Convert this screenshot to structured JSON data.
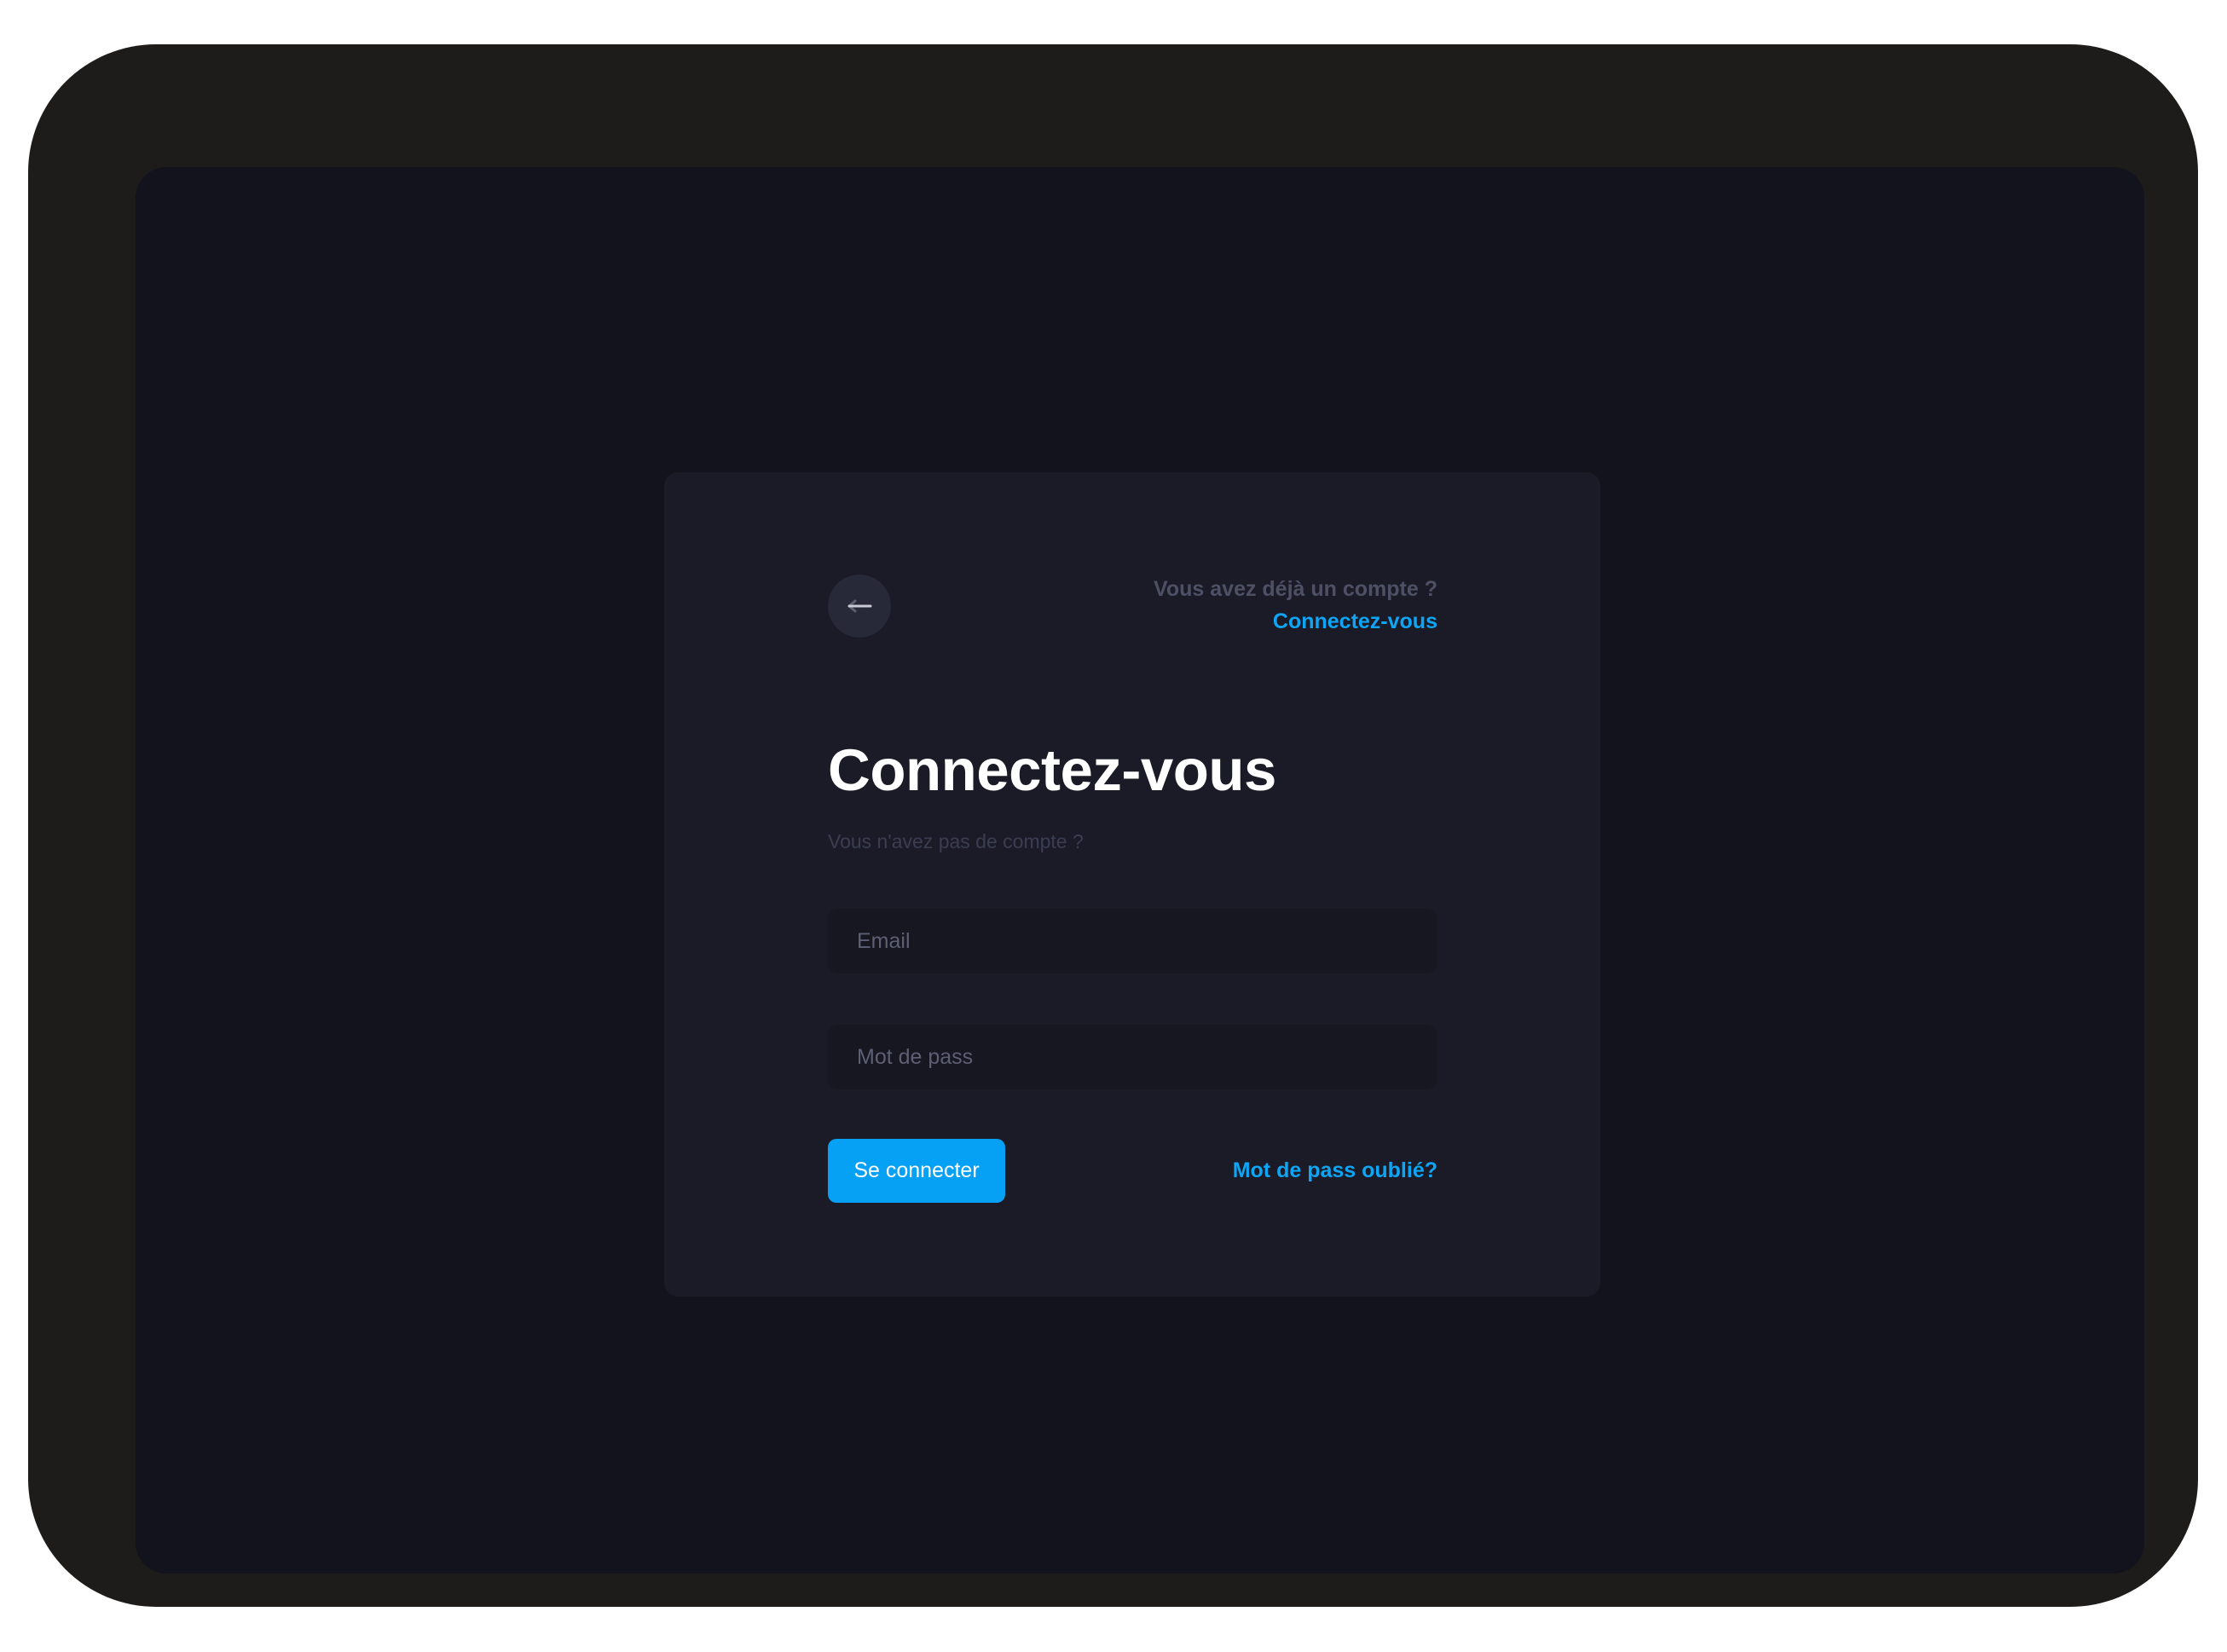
{
  "header": {
    "back_icon": "arrow-left-icon",
    "account_question": "Vous avez déjà un compte ?",
    "account_link": "Connectez-vous"
  },
  "form": {
    "title": "Connectez-vous",
    "subtitle": "Vous n'avez pas de compte ?",
    "email": {
      "value": "",
      "placeholder": "Email"
    },
    "password": {
      "value": "",
      "placeholder": "Mot de pass"
    },
    "submit_label": "Se connecter",
    "forgot_label": "Mot de pass oublié?"
  },
  "colors": {
    "device_frame": "#1d1c1a",
    "screen_background": "#12131c",
    "card_background": "#1a1b26",
    "input_background": "#161720",
    "accent": "#06a0f5",
    "link": "#0ea5f5",
    "title_text": "#ffffff",
    "muted_text": "#4e5066"
  }
}
